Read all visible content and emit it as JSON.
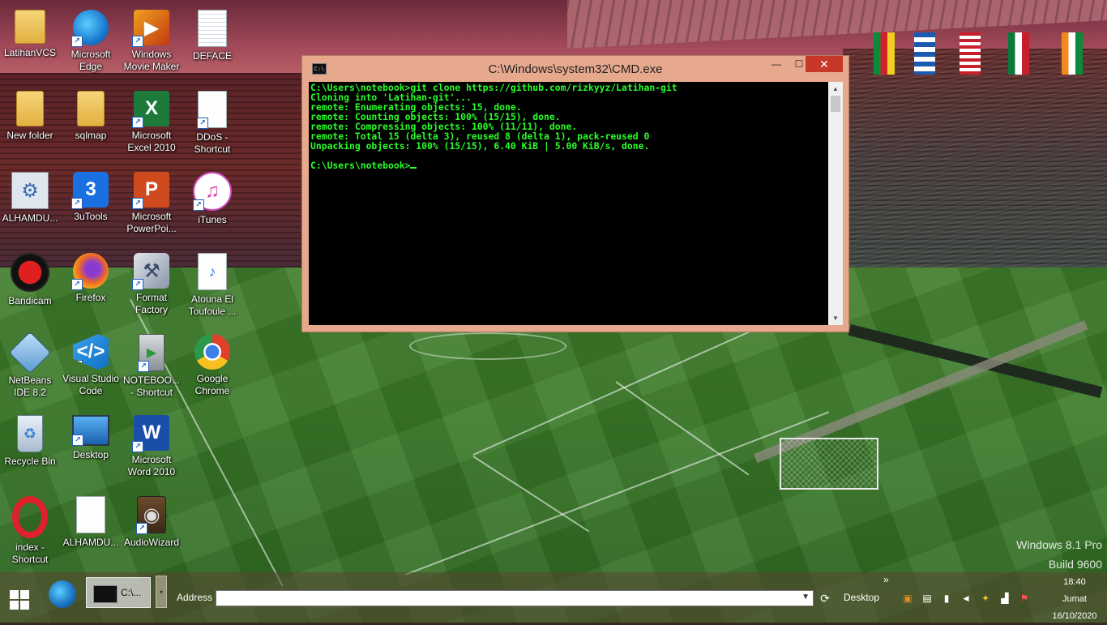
{
  "desktop": {
    "icons": [
      {
        "label": "LatihanVCS",
        "icon": "folder-icon"
      },
      {
        "label": "Microsoft Edge",
        "icon": "edge-icon"
      },
      {
        "label": "Windows Movie Maker",
        "icon": "movie-maker-icon"
      },
      {
        "label": "DEFACE",
        "icon": "document-icon"
      },
      {
        "label": "New folder",
        "icon": "folder-icon"
      },
      {
        "label": "sqlmap",
        "icon": "folder-icon"
      },
      {
        "label": "Microsoft Excel 2010",
        "icon": "excel-icon"
      },
      {
        "label": "DDoS - Shortcut",
        "icon": "document-icon"
      },
      {
        "label": "ALHAMDU...",
        "icon": "settings-icon"
      },
      {
        "label": "3uTools",
        "icon": "3utools-icon"
      },
      {
        "label": "Microsoft PowerPoi...",
        "icon": "powerpoint-icon"
      },
      {
        "label": "iTunes",
        "icon": "itunes-icon"
      },
      {
        "label": "Bandicam",
        "icon": "bandicam-icon"
      },
      {
        "label": "Firefox",
        "icon": "firefox-icon"
      },
      {
        "label": "Format Factory",
        "icon": "format-factory-icon"
      },
      {
        "label": "Atouna El Toufoule ...",
        "icon": "mp3-icon"
      },
      {
        "label": "NetBeans IDE 8.2",
        "icon": "netbeans-icon"
      },
      {
        "label": "Visual Studio Code",
        "icon": "vscode-icon"
      },
      {
        "label": "NOTEBOO... - Shortcut",
        "icon": "computer-icon"
      },
      {
        "label": "Google Chrome",
        "icon": "chrome-icon"
      },
      {
        "label": "Recycle Bin",
        "icon": "recycle-bin-icon"
      },
      {
        "label": "Desktop",
        "icon": "desktop-icon"
      },
      {
        "label": "Microsoft Word 2010",
        "icon": "word-icon"
      },
      {
        "label": "index - Shortcut",
        "icon": "opera-icon"
      },
      {
        "label": "ALHAMDU...",
        "icon": "document-icon"
      },
      {
        "label": "AudioWizard",
        "icon": "audio-wizard-icon"
      }
    ],
    "watermark_line1": "Windows 8.1 Pro",
    "watermark_line2": "Build 9600"
  },
  "cmd_window": {
    "title": "C:\\Windows\\system32\\CMD.exe",
    "minimize": "—",
    "maximize": "☐",
    "close": "✕",
    "lines": [
      "C:\\Users\\notebook>git clone https://github.com/rizkyyz/Latihan-git",
      "Cloning into 'Latihan-git'...",
      "remote: Enumerating objects: 15, done.",
      "remote: Counting objects: 100% (15/15), done.",
      "remote: Compressing objects: 100% (11/11), done.",
      "remote: Total 15 (delta 3), reused 8 (delta 1), pack-reused 0",
      "Unpacking objects: 100% (15/15), 6.40 KiB | 5.00 KiB/s, done.",
      "",
      "C:\\Users\\notebook>"
    ]
  },
  "taskbar": {
    "cmd_task_label": "C:\\...",
    "address_label": "Address",
    "address_value": "",
    "desktop_label": "Desktop",
    "overflow": "»",
    "time": "18:40",
    "day": "Jumat",
    "date": "16/10/2020"
  },
  "colors": {
    "console_text": "#29ff29",
    "window_frame": "#e7a98e",
    "close_button": "#c7382a"
  }
}
